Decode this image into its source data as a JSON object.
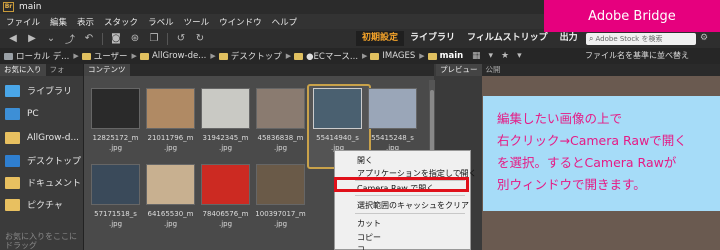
{
  "window": {
    "title": "main",
    "app_icon_text": "Br"
  },
  "menu": [
    "ファイル",
    "編集",
    "表示",
    "スタック",
    "ラベル",
    "ツール",
    "ウインドウ",
    "ヘルプ"
  ],
  "brand_badge": "Adobe Bridge",
  "workspaces": {
    "tabs": [
      "初期設定",
      "ライブラリ",
      "フィルムストリップ",
      "出力"
    ],
    "active_index": 0,
    "more": "▾"
  },
  "search": {
    "placeholder": "Adobe Stock を検索"
  },
  "breadcrumb": [
    {
      "label": "ローカル デ..."
    },
    {
      "label": "ユーザー"
    },
    {
      "label": "AllGrow-de..."
    },
    {
      "label": "デスクトップ"
    },
    {
      "label": "●ECマース..."
    },
    {
      "label": "IMAGES"
    },
    {
      "label": "main"
    }
  ],
  "sort": {
    "label": "ファイル名を基準に並べ替え"
  },
  "left_panel": {
    "tabs": [
      "お気に入り",
      "フォ"
    ],
    "favorites": [
      {
        "label": "ライブラリ",
        "color": "#4aa6e8"
      },
      {
        "label": "PC",
        "color": "#3d8fd6"
      },
      {
        "label": "AllGrow-d...",
        "color": "#e8c060"
      },
      {
        "label": "デスクトップ",
        "color": "#2f7fd0"
      },
      {
        "label": "ドキュメント",
        "color": "#e8c060"
      },
      {
        "label": "ピクチャ",
        "color": "#e8c060"
      }
    ],
    "note": "お気に入りをここにドラッグ"
  },
  "content": {
    "tabs": [
      "コンテンツ"
    ],
    "thumbnails": [
      {
        "line1": "12825172_m",
        "line2": ".jpg",
        "color": "#2a2a2a"
      },
      {
        "line1": "21011796_m",
        "line2": ".jpg",
        "color": "#b08a64"
      },
      {
        "line1": "31942345_m",
        "line2": ".jpg",
        "color": "#c9c9c4"
      },
      {
        "line1": "45836838_m",
        "line2": ".jpg",
        "color": "#8a7b70"
      },
      {
        "line1": "55414940_s",
        "line2": ".jpg",
        "color": "#4a6070",
        "selected": true
      },
      {
        "line1": "55415248_s",
        "line2": ".jpg",
        "color": "#9aa6b8"
      },
      {
        "line1": "57171518_s",
        "line2": ".jpg",
        "color": "#3a4a5a"
      },
      {
        "line1": "64165530_m",
        "line2": ".jpg",
        "color": "#c8b090"
      },
      {
        "line1": "78406576_m",
        "line2": ".jpg",
        "color": "#cc2a22"
      },
      {
        "line1": "100397017_m",
        "line2": ".jpg",
        "color": "#6a5a48"
      }
    ]
  },
  "right_panel": {
    "tabs": [
      "プレビュー",
      "公開"
    ]
  },
  "context_menu": {
    "items": [
      "開く",
      "アプリケーションを指定して開く",
      "Camera Raw で開く...",
      "選択範囲のキャッシュをクリア",
      "カット",
      "コピー",
      "コ..."
    ],
    "submenu_marker": "›"
  },
  "callout": {
    "lines": [
      "編集したい画像の上で",
      "右クリック→Camera Rawで開く",
      "を選択。するとCamera Rawが",
      "別ウィンドウで開きます。"
    ]
  }
}
